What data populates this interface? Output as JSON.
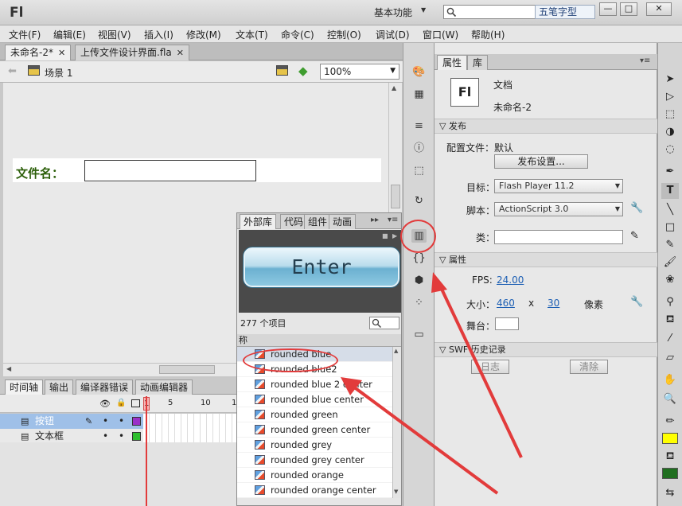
{
  "app": {
    "logo": "Fl",
    "workspace": "基本功能",
    "ime_label": "五笔字型",
    "window_buttons": [
      "—",
      "□",
      "✕"
    ]
  },
  "menu": [
    "文件(F)",
    "编辑(E)",
    "视图(V)",
    "插入(I)",
    "修改(M)",
    "文本(T)",
    "命令(C)",
    "控制(O)",
    "调试(D)",
    "窗口(W)",
    "帮助(H)"
  ],
  "doc_tabs": [
    {
      "label": "未命名-2*",
      "active": true
    },
    {
      "label": "上传文件设计界面.fla",
      "active": false
    }
  ],
  "scene": {
    "label": "场景 1",
    "zoom": "100%"
  },
  "stage": {
    "label": "文件名："
  },
  "timeline": {
    "tabs": [
      "时间轴",
      "输出",
      "编译器错误",
      "动画编辑器"
    ],
    "frame_numbers": [
      "1",
      "5",
      "10",
      "1"
    ],
    "layers": [
      {
        "name": "按钮",
        "selected": true,
        "color": "#9b30c9"
      },
      {
        "name": "文本框",
        "selected": false,
        "color": "#2fbf2f"
      }
    ]
  },
  "library": {
    "tabs": [
      "外部库",
      "代码",
      "组件",
      "动画"
    ],
    "preview_text": "Enter",
    "count": "277 个项目",
    "column_header": "称",
    "items": [
      "rounded blue",
      "rounded blue2",
      "rounded blue 2 center",
      "rounded blue center",
      "rounded green",
      "rounded green center",
      "rounded grey",
      "rounded grey center",
      "rounded orange",
      "rounded orange center"
    ]
  },
  "properties": {
    "tabs": [
      "属性",
      "库"
    ],
    "doc_type": "文档",
    "doc_name": "未命名-2",
    "doc_icon": "Fl",
    "publish_section": "发布",
    "profile_label": "配置文件：",
    "profile_value": "默认",
    "publish_settings_btn": "发布设置...",
    "target_label": "目标：",
    "target_value": "Flash Player 11.2",
    "script_label": "脚本：",
    "script_value": "ActionScript 3.0",
    "class_label": "类：",
    "props_section": "属性",
    "fps_label": "FPS:",
    "fps_value": "24.00",
    "size_label": "大小：",
    "width": "460",
    "x_sep": "x",
    "height": "30",
    "unit": "像素",
    "stage_label": "舞台：",
    "swf_section": "SWF 历史记录",
    "log_btn": "日志",
    "clear_btn": "清除"
  },
  "accent_color": "#e23b3b"
}
